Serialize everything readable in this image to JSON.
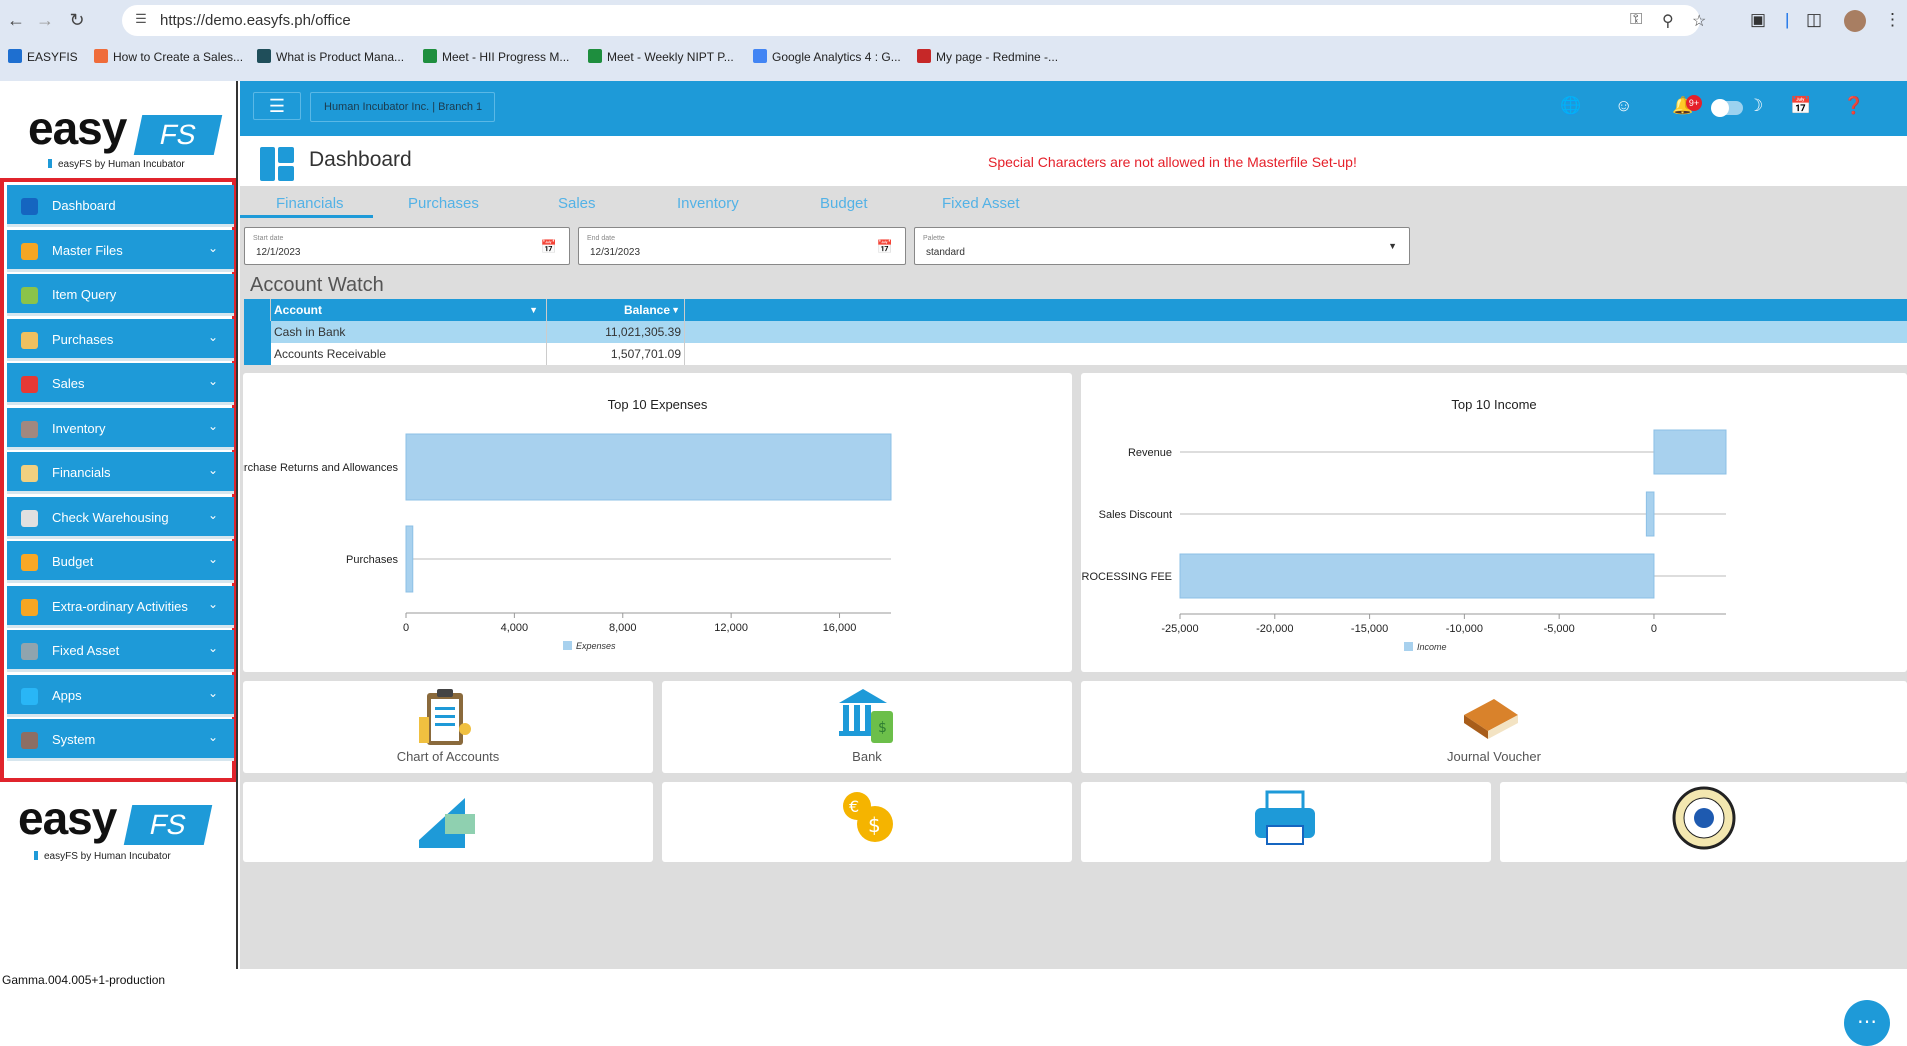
{
  "browser": {
    "url": "https://demo.easyfs.ph/office",
    "bookmarks": [
      {
        "label": "EASYFIS",
        "color": "#1e6fd0"
      },
      {
        "label": "How to Create a Sales...",
        "color": "#ef6c3a"
      },
      {
        "label": "What is Product Mana...",
        "color": "#1f4e5a"
      },
      {
        "label": "Meet - HII Progress M...",
        "color": "#1e8e3e"
      },
      {
        "label": "Meet - Weekly NIPT P...",
        "color": "#1e8e3e"
      },
      {
        "label": "Google Analytics 4 : G...",
        "color": "#4285f4"
      },
      {
        "label": "My page - Redmine -...",
        "color": "#c62828"
      }
    ]
  },
  "brand": {
    "easy": "easy",
    "fs": "FS",
    "tagline": "easyFS by Human Incubator"
  },
  "sidebar": {
    "items": [
      {
        "label": "Dashboard",
        "icon": "dashboard-icon",
        "icon_color": "#1565c0",
        "chevron": false
      },
      {
        "label": "Master Files",
        "icon": "master-files-icon",
        "icon_color": "#f5a623",
        "chevron": true
      },
      {
        "label": "Item Query",
        "icon": "item-query-icon",
        "icon_color": "#8bc34a",
        "chevron": false
      },
      {
        "label": "Purchases",
        "icon": "purchases-icon",
        "icon_color": "#f0c060",
        "chevron": true
      },
      {
        "label": "Sales",
        "icon": "sales-icon",
        "icon_color": "#e53935",
        "chevron": true
      },
      {
        "label": "Inventory",
        "icon": "inventory-icon",
        "icon_color": "#a1887f",
        "chevron": true
      },
      {
        "label": "Financials",
        "icon": "financials-icon",
        "icon_color": "#f0d080",
        "chevron": true
      },
      {
        "label": "Check Warehousing",
        "icon": "check-warehousing-icon",
        "icon_color": "#e0e0e0",
        "chevron": true
      },
      {
        "label": "Budget",
        "icon": "budget-icon",
        "icon_color": "#f9a825",
        "chevron": true
      },
      {
        "label": "Extra-ordinary Activities",
        "icon": "activities-icon",
        "icon_color": "#f5a623",
        "chevron": true
      },
      {
        "label": "Fixed Asset",
        "icon": "fixed-asset-icon",
        "icon_color": "#90a4ae",
        "chevron": true
      },
      {
        "label": "Apps",
        "icon": "apps-icon",
        "icon_color": "#29b6f6",
        "chevron": true
      },
      {
        "label": "System",
        "icon": "system-icon",
        "icon_color": "#8d6e63",
        "chevron": true
      }
    ],
    "version": "Gamma.004.005+1-production"
  },
  "topbar": {
    "branch": "Human Incubator Inc. | Branch 1",
    "notifications": "9+"
  },
  "page": {
    "title": "Dashboard",
    "warning": "Special Characters are not allowed in the Masterfile Set-up!",
    "tabs": [
      "Financials",
      "Purchases",
      "Sales",
      "Inventory",
      "Budget",
      "Fixed Asset"
    ],
    "active_tab": "Financials"
  },
  "filters": {
    "start_label": "Start date",
    "start_value": "12/1/2023",
    "end_label": "End date",
    "end_value": "12/31/2023",
    "palette_label": "Palette",
    "palette_value": "standard"
  },
  "account_watch": {
    "title": "Account Watch",
    "col_account": "Account",
    "col_balance": "Balance",
    "rows": [
      {
        "account": "Cash in Bank",
        "balance": "11,021,305.39"
      },
      {
        "account": "Accounts Receivable",
        "balance": "1,507,701.09"
      }
    ]
  },
  "chart_data": [
    {
      "type": "bar",
      "orientation": "horizontal",
      "title": "Top 10 Expenses",
      "categories": [
        "Purchase Returns and Allowances",
        "Purchases"
      ],
      "series": [
        {
          "name": "Expenses",
          "values": [
            17900,
            250
          ]
        }
      ],
      "xlim": [
        0,
        17900
      ],
      "xticks": [
        0,
        4000,
        8000,
        12000,
        16000
      ],
      "xtick_labels": [
        "0",
        "4,000",
        "8,000",
        "12,000",
        "16,000"
      ],
      "legend": "bottom",
      "color": "#a8d1ee"
    },
    {
      "type": "bar",
      "orientation": "horizontal",
      "title": "Top 10 Income",
      "categories": [
        "Revenue",
        "Sales Discount",
        "PROCESSING FEE"
      ],
      "series": [
        {
          "name": "Income",
          "values": [
            3800,
            -400,
            -25000
          ]
        }
      ],
      "xlim": [
        -25000,
        3800
      ],
      "xticks": [
        -25000,
        -20000,
        -15000,
        -10000,
        -5000,
        0
      ],
      "xtick_labels": [
        "-25,000",
        "-20,000",
        "-15,000",
        "-10,000",
        "-5,000",
        "0"
      ],
      "legend": "bottom",
      "color": "#a8d1ee"
    }
  ],
  "tiles": [
    {
      "label": "Chart of Accounts",
      "icon": "clipboard-icon"
    },
    {
      "label": "Bank",
      "icon": "bank-icon"
    },
    {
      "label": "Journal Voucher",
      "icon": "book-icon"
    },
    {
      "label": "",
      "icon": "check-icon"
    },
    {
      "label": "",
      "icon": "currency-exchange-icon"
    },
    {
      "label": "",
      "icon": "printer-icon"
    },
    {
      "label": "",
      "icon": "seal-icon"
    }
  ]
}
